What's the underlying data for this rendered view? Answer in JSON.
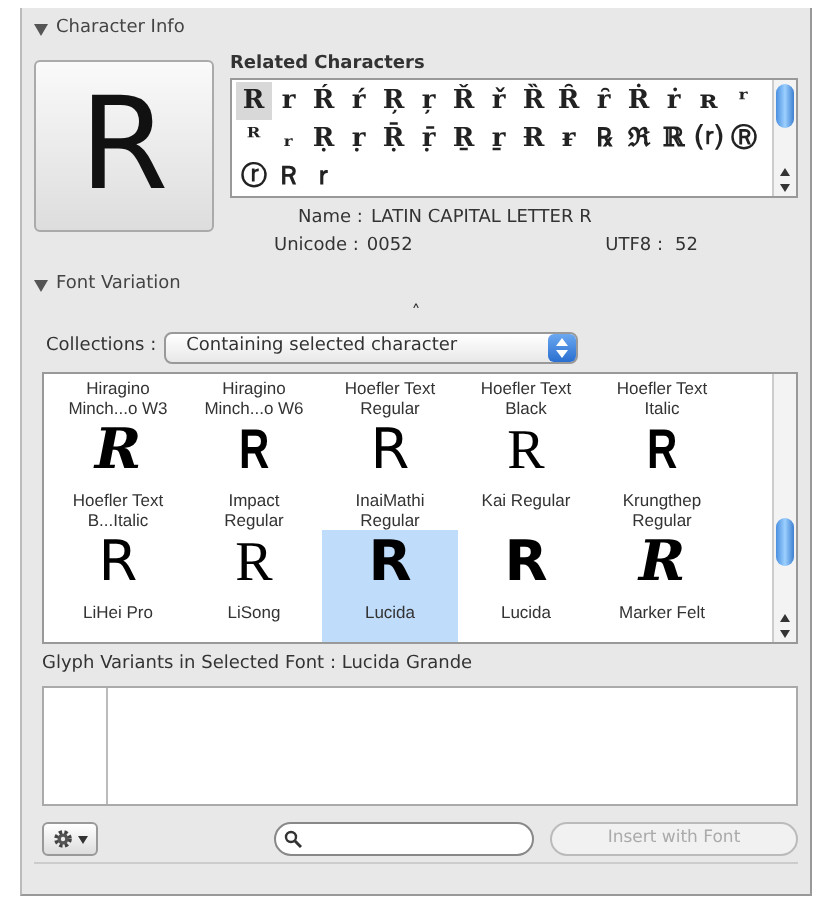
{
  "character_info": {
    "header": "Character Info",
    "expanded": true,
    "preview": "R",
    "related_label": "Related Characters",
    "related": [
      {
        "char": "R",
        "selected": true
      },
      {
        "char": "r",
        "selected": false
      },
      {
        "char": "Ŕ",
        "selected": false
      },
      {
        "char": "ŕ",
        "selected": false
      },
      {
        "char": "Ŗ",
        "selected": false
      },
      {
        "char": "ŗ",
        "selected": false
      },
      {
        "char": "Ř",
        "selected": false
      },
      {
        "char": "ř",
        "selected": false
      },
      {
        "char": "Ȑ",
        "selected": false
      },
      {
        "char": "Ȓ",
        "selected": false
      },
      {
        "char": "ȓ",
        "selected": false
      },
      {
        "char": "Ṙ",
        "selected": false
      },
      {
        "char": "ṙ",
        "selected": false
      },
      {
        "char": "ʀ",
        "selected": false
      },
      {
        "char": "ʳ",
        "selected": false
      },
      {
        "char": "ᴿ",
        "selected": false
      },
      {
        "char": "ᵣ",
        "selected": false
      },
      {
        "char": "Ṛ",
        "selected": false
      },
      {
        "char": "ṛ",
        "selected": false
      },
      {
        "char": "Ṝ",
        "selected": false
      },
      {
        "char": "ṝ",
        "selected": false
      },
      {
        "char": "Ṟ",
        "selected": false
      },
      {
        "char": "ṟ",
        "selected": false
      },
      {
        "char": "Ɍ",
        "selected": false
      },
      {
        "char": "ɍ",
        "selected": false
      },
      {
        "char": "℞",
        "selected": false
      },
      {
        "char": "ℜ",
        "selected": false
      },
      {
        "char": "ℝ",
        "selected": false
      },
      {
        "char": "⒭",
        "selected": false
      },
      {
        "char": "Ⓡ",
        "selected": false
      },
      {
        "char": "ⓡ",
        "selected": false
      },
      {
        "char": "Ｒ",
        "selected": false
      },
      {
        "char": "ｒ",
        "selected": false
      }
    ],
    "name_label": "Name :",
    "name": "LATIN CAPITAL LETTER R",
    "unicode_label": "Unicode :",
    "unicode": "0052",
    "utf8_label": "UTF8 :",
    "utf8": "52"
  },
  "font_variation": {
    "header": "Font Variation",
    "expanded": true,
    "collapse_caret": "˄",
    "collections_label": "Collections :",
    "collection": "Containing selected character",
    "fonts": [
      {
        "name": "Hiragino Minch...o W3",
        "kind": "label",
        "selected": false
      },
      {
        "name": "Hiragino Minch...o W6",
        "kind": "label",
        "selected": false
      },
      {
        "name": "Hoefler Text Regular",
        "kind": "label",
        "selected": false
      },
      {
        "name": "Hoefler Text Black",
        "kind": "label",
        "selected": false
      },
      {
        "name": "Hoefler Text Italic",
        "kind": "label",
        "selected": false
      },
      {
        "name": "Hoefler Text B...Italic",
        "glyph": "R",
        "kind": "bold-italic",
        "selected": false
      },
      {
        "name": "Impact Regular",
        "glyph": "R",
        "kind": "condensed",
        "selected": false
      },
      {
        "name": "InaiMathi Regular",
        "glyph": "R",
        "kind": "sans",
        "selected": false
      },
      {
        "name": "Kai Regular",
        "glyph": "R",
        "kind": "serif",
        "selected": false
      },
      {
        "name": "Krungthep Regular",
        "glyph": "R",
        "kind": "condensed",
        "selected": false
      },
      {
        "name": "LiHei Pro",
        "glyph": "R",
        "kind": "sans",
        "selected": false
      },
      {
        "name": "LiSong",
        "glyph": "R",
        "kind": "serif",
        "selected": false
      },
      {
        "name": "Lucida",
        "glyph": "R",
        "kind": "bold",
        "selected": true
      },
      {
        "name": "Lucida",
        "glyph": "R",
        "kind": "bold",
        "selected": false
      },
      {
        "name": "Marker Felt",
        "glyph": "R",
        "kind": "bold-italic",
        "selected": false
      }
    ],
    "variants_label": "Glyph Variants in Selected Font : Lucida Grande"
  },
  "toolbar": {
    "insert_button": "Insert with Font",
    "insert_disabled": true
  }
}
